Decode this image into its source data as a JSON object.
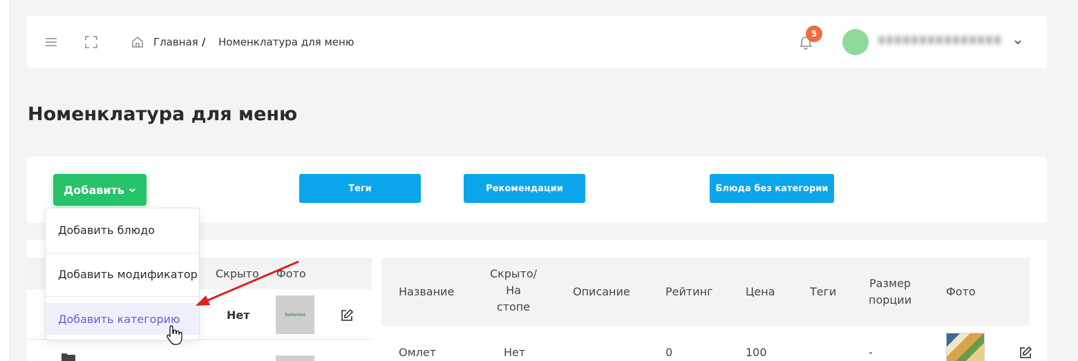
{
  "header": {
    "breadcrumb_home": "Главная",
    "breadcrumb_separator": "/",
    "breadcrumb_current": "Номенклатура для меню",
    "notification_count": "5"
  },
  "page_title": "Номенклатура для меню",
  "toolbar": {
    "add_label": "Добавить",
    "tags_label": "Теги",
    "recommendations_label": "Рекомендации",
    "no_category_label": "Блюда без категории"
  },
  "add_menu": {
    "items": [
      {
        "label": "Добавить блюдо"
      },
      {
        "label": "Добавить модификатор"
      },
      {
        "label": "Добавить категорию"
      }
    ]
  },
  "categories_table": {
    "columns": [
      "Скрыто",
      "Фото"
    ],
    "rows": [
      {
        "hidden": "Нет",
        "photo_text": "ReMarked"
      }
    ]
  },
  "dishes_table": {
    "columns": [
      "Название",
      "Скрыто/",
      "На",
      "стопе",
      "Описание",
      "Рейтинг",
      "Цена",
      "Теги",
      "Размер",
      "порции",
      "Фото"
    ],
    "rows": [
      {
        "name": "Омлет",
        "hidden": "Нет",
        "description": "",
        "rating": "0",
        "price": "100",
        "tags": "",
        "portion": "-"
      }
    ]
  },
  "colors": {
    "primary_green": "#27c26a",
    "primary_blue": "#0ba5ec",
    "badge": "#f26b3a",
    "active_item": "#6a5cd8",
    "arrow": "#e0201a"
  }
}
